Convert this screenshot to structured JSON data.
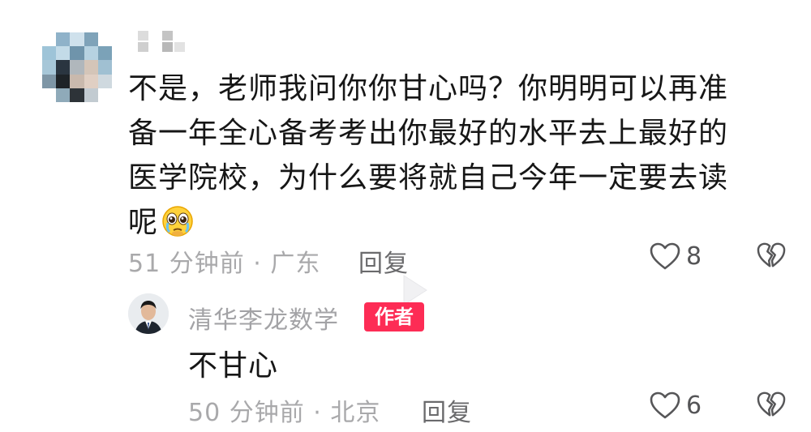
{
  "comment": {
    "avatar_icon": "pixelated-avatar-icon",
    "lines": [
      "不是，老师我问你你甘心吗？你明明可以再准",
      "备一年全心备考考出你最好的水平去上最好的",
      "医学院校，为什么要将就自己今年一定要去读",
      "呢"
    ],
    "emoji": "pleading-face-emoji",
    "time": "51 分钟前 · 广东",
    "reply_label": "回复",
    "like_count": "8"
  },
  "reply": {
    "author_name": "清华李龙数学",
    "author_badge": "作者",
    "text": "不甘心",
    "time": "50 分钟前 · 北京",
    "reply_label": "回复",
    "like_count": "6"
  },
  "colors": {
    "badge": "#fd2c55",
    "text_primary": "#161616",
    "text_secondary": "#a9a9ab"
  }
}
